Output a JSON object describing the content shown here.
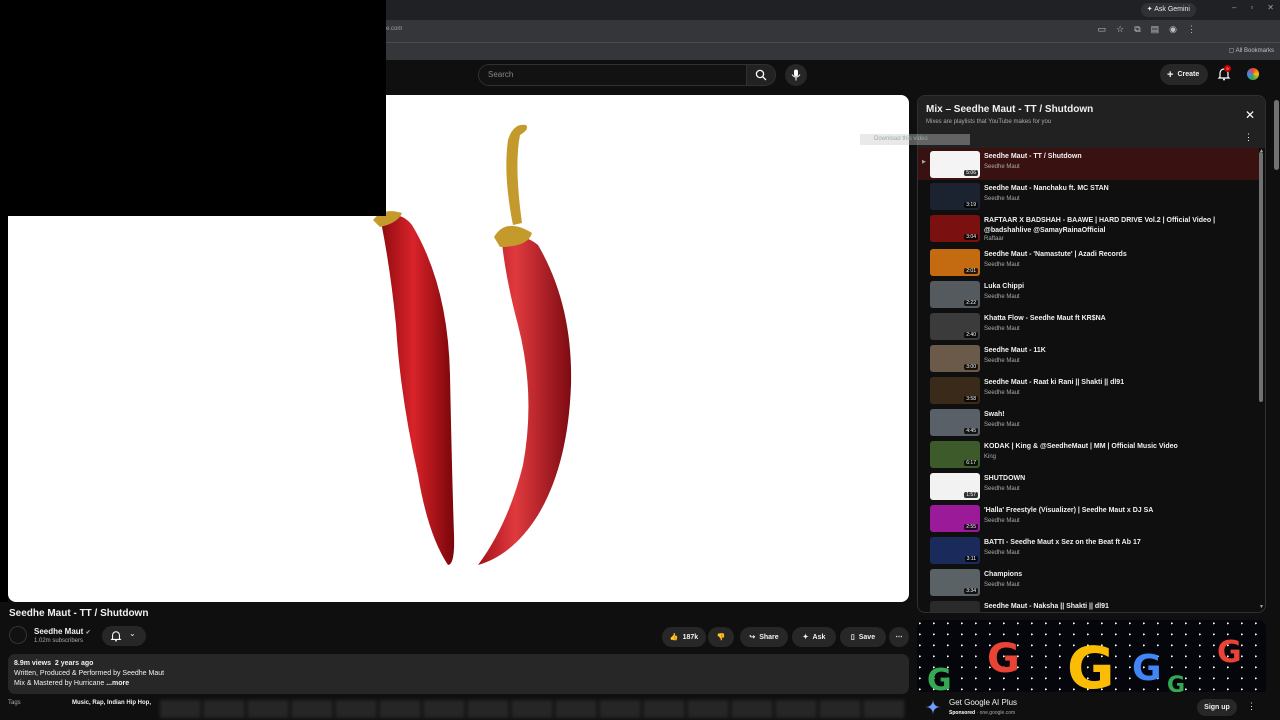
{
  "browser": {
    "ask_gemini": "Ask Gemini",
    "url_fragment": "e.com",
    "bookmarks_label": "All Bookmarks",
    "minimize": "–",
    "maximize": "▫",
    "close": "✕"
  },
  "masthead": {
    "search_placeholder": "Search",
    "create_label": "Create",
    "notif_count": "9"
  },
  "player": {
    "download_badge": "Download this video",
    "colors": {
      "chili": "#c1141a",
      "stem": "#c49a2c"
    }
  },
  "video": {
    "title": "Seedhe Maut - TT / Shutdown",
    "channel": "Seedhe Maut",
    "subscribers": "1.02m subscribers",
    "like_count": "187k",
    "share_label": "Share",
    "ask_label": "Ask",
    "save_label": "Save",
    "views": "8.9m views",
    "age": "2 years ago",
    "desc_line1": "Written, Produced & Performed by Seedhe Maut",
    "desc_line2": "Mix & Mastered by Hurricane",
    "more_label": "...more",
    "tags_label": "Tags",
    "tags_visible": "Music, Rap, Indian Hip Hop,"
  },
  "playlist": {
    "title": "Mix – Seedhe Maut - TT / Shutdown",
    "subtitle": "Mixes are playlists that YouTube makes for you",
    "items": [
      {
        "title": "Seedhe Maut - TT / Shutdown",
        "channel": "Seedhe Maut",
        "duration": "5:06",
        "thumb": "#f4f4f4",
        "active": true
      },
      {
        "title": "Seedhe Maut - Nanchaku ft. MC STAN",
        "channel": "Seedhe Maut",
        "duration": "3:19",
        "thumb": "#1b2330"
      },
      {
        "title": "RAFTAAR X BADSHAH - BAAWE | HARD DRIVE Vol.2 | Official Video | @badshahlive @SamayRainaOfficial",
        "channel": "Raftaar",
        "duration": "3:04",
        "thumb": "#7a1010"
      },
      {
        "title": "Seedhe Maut - 'Namastute' | Azadi Records",
        "channel": "Seedhe Maut",
        "duration": "2:01",
        "thumb": "#c46a10"
      },
      {
        "title": "Luka Chippi",
        "channel": "Seedhe Maut",
        "duration": "2:22",
        "thumb": "#555a5e"
      },
      {
        "title": "Khatta Flow - Seedhe Maut ft KR$NA",
        "channel": "Seedhe Maut",
        "duration": "2:40",
        "thumb": "#3b3b3b"
      },
      {
        "title": "Seedhe Maut - 11K",
        "channel": "Seedhe Maut",
        "duration": "3:00",
        "thumb": "#6b5a4a"
      },
      {
        "title": "Seedhe Maut - Raat ki Rani || Shakti || dl91",
        "channel": "Seedhe Maut",
        "duration": "3:58",
        "thumb": "#3a2a1a"
      },
      {
        "title": "Swah!",
        "channel": "Seedhe Maut",
        "duration": "4:45",
        "thumb": "#5a6068"
      },
      {
        "title": "KODAK | King & @SeedheMaut | MM | Official Music Video",
        "channel": "King",
        "duration": "6:17",
        "thumb": "#3c5a2a"
      },
      {
        "title": "SHUTDOWN",
        "channel": "Seedhe Maut",
        "duration": "1:57",
        "thumb": "#f2f2f2"
      },
      {
        "title": "'Halla' Freestyle (Visualizer) | Seedhe Maut x DJ SA",
        "channel": "Seedhe Maut",
        "duration": "2:55",
        "thumb": "#9a1a9a"
      },
      {
        "title": "BATTI - Seedhe Maut x Sez on the Beat ft Ab 17",
        "channel": "Seedhe Maut",
        "duration": "3:11",
        "thumb": "#1a2a5a"
      },
      {
        "title": "Champions",
        "channel": "Seedhe Maut",
        "duration": "3:34",
        "thumb": "#5a6266"
      },
      {
        "title": "Seedhe Maut - Naksha || Shakti || dl91",
        "channel": "Seedhe Maut",
        "duration": "",
        "thumb": "#2a2a2a"
      }
    ]
  },
  "ad": {
    "title": "Get Google AI Plus",
    "sponsored": "Sponsored",
    "domain": "· one.google.com",
    "signup_label": "Sign up"
  }
}
